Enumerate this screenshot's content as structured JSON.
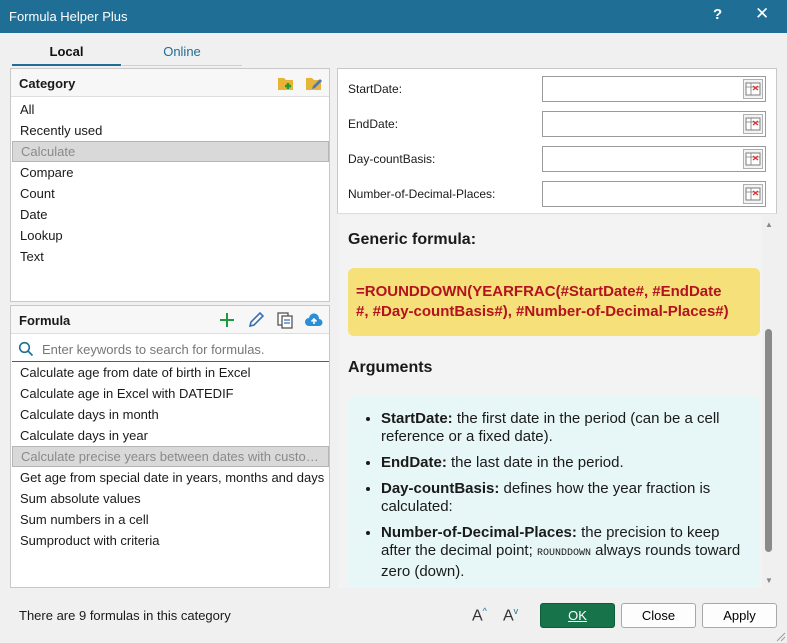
{
  "window": {
    "title": "Formula Helper Plus",
    "help_glyph": "?",
    "close_glyph": "✕"
  },
  "tabs": [
    "Local",
    "Online"
  ],
  "category": {
    "header": "Category",
    "items": [
      "All",
      "Recently used",
      "Calculate",
      "Compare",
      "Count",
      "Date",
      "Lookup",
      "Text"
    ],
    "selected_index": 2
  },
  "formula": {
    "header": "Formula",
    "search_placeholder": "Enter keywords to search for formulas.",
    "items": [
      "Calculate age from date of birth in Excel",
      "Calculate age in Excel with DATEDIF",
      "Calculate days in month",
      "Calculate days in year",
      "Calculate precise years between dates with custom decimals",
      "Get age from special date in years, months and days",
      "Sum absolute values",
      "Sum numbers in a cell",
      "Sumproduct with criteria"
    ],
    "selected_index": 4
  },
  "status": "There are 9 formulas in this category",
  "arguments": [
    {
      "label": "StartDate:",
      "value": ""
    },
    {
      "label": "EndDate:",
      "value": ""
    },
    {
      "label": "Day-countBasis:",
      "value": ""
    },
    {
      "label": "Number-of-Decimal-Places:",
      "value": ""
    }
  ],
  "doc": {
    "generic_heading": "Generic formula:",
    "formula_line1": "=ROUNDDOWN(YEARFRAC(#StartDate#, #EndDate",
    "formula_line2": "#, #Day-countBasis#), #Number-of-Decimal-Places#)",
    "args_heading": "Arguments",
    "args": [
      {
        "name": "StartDate:",
        "desc": "the first date in the period (can be a cell reference or a fixed date)."
      },
      {
        "name": "EndDate:",
        "desc": "the last date in the period."
      },
      {
        "name": "Day-countBasis:",
        "desc": "defines how the year fraction is calculated:"
      },
      {
        "name": "Number-of-Decimal-Places:",
        "desc_pre": "the precision to keep after the decimal point;",
        "code": "ROUNDDOWN",
        "desc_post": "always rounds toward zero (down)."
      }
    ]
  },
  "buttons": {
    "ok": "OK",
    "close": "Close",
    "apply": "Apply"
  },
  "icons": {
    "title_accent": "#1f6e95",
    "ok_color": "#16734a",
    "formula_color": "#b3121e",
    "formula_bg": "#f5e07a",
    "args_bg": "#e7f6f7"
  }
}
